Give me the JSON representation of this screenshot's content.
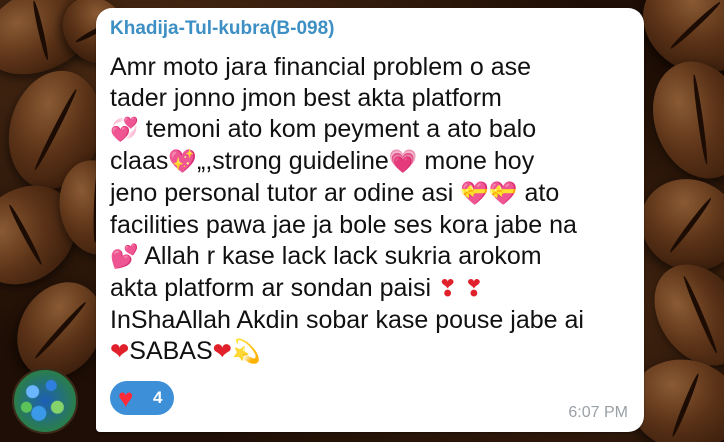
{
  "message": {
    "sender": "Khadija-Tul-kubra(B-098)",
    "lines": [
      "Amr moto jara financial problem o ase",
      "tader jonno jmon best akta platform",
      "temoni ato kom peyment a ato balo",
      "claas",
      "„,strong guideline",
      "mone hoy",
      "jeno personal tutor ar odine asi",
      "ato",
      "facilities pawa jae ja bole ses kora jabe na",
      "Allah r kase lack lack sukria arokom",
      "akta platform ar sondan paisi",
      "InShaAllah Akdin sobar kase pouse jabe ai",
      "SABAS"
    ],
    "time": "6:07 PM",
    "reaction": {
      "icon": "heart-icon",
      "count": "4",
      "color": "#3d8fd8"
    }
  },
  "colors": {
    "sender": "#3d8fc4",
    "bubble": "#ffffff",
    "reaction_bg": "#3d8fd8"
  }
}
